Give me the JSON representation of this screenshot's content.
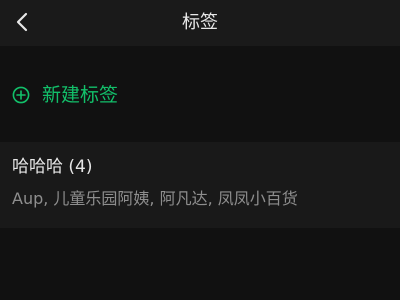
{
  "header": {
    "title": "标签",
    "back_icon": "chevron-left-icon"
  },
  "new_tag": {
    "label": "新建标签",
    "icon": "plus-circle-icon",
    "color": "#12c06a"
  },
  "tag_groups": [
    {
      "title": "哈哈哈 (4)",
      "members": "Aup, 儿童乐园阿姨, 阿凡达, 凤凤小百货"
    }
  ],
  "colors": {
    "background": "#111111",
    "nav_background": "#1a1a1a",
    "accent": "#12c06a",
    "primary_text": "#e6e6e6",
    "secondary_text": "#8e8e8e"
  }
}
